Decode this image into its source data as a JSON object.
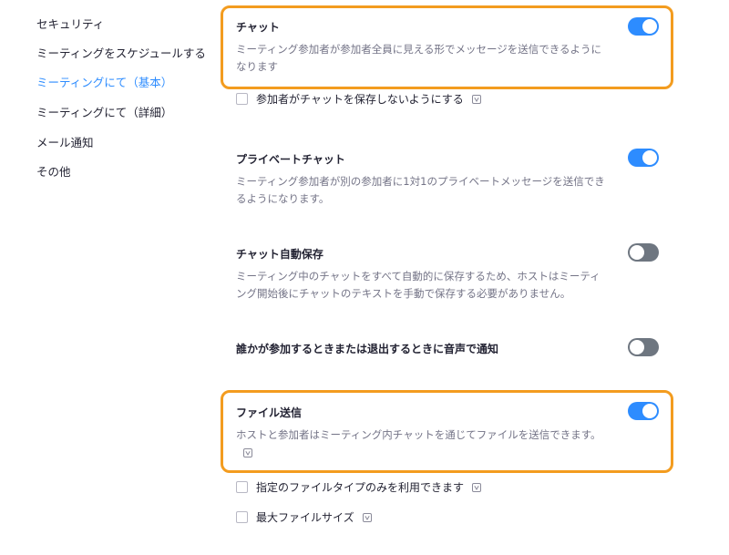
{
  "sidebar": {
    "items": [
      {
        "label": "セキュリティ",
        "active": false
      },
      {
        "label": "ミーティングをスケジュールする",
        "active": false
      },
      {
        "label": "ミーティングにて（基本）",
        "active": true
      },
      {
        "label": "ミーティングにて（詳細）",
        "active": false
      },
      {
        "label": "メール通知",
        "active": false
      },
      {
        "label": "その他",
        "active": false
      }
    ]
  },
  "settings": {
    "chat": {
      "title": "チャット",
      "desc": "ミーティング参加者が参加者全員に見える形でメッセージを送信できるようになります",
      "enabled": true,
      "highlighted": true,
      "options": [
        {
          "label": "参加者がチャットを保存しないようにする",
          "checked": false,
          "lock_icon": "lock-icon"
        }
      ]
    },
    "private_chat": {
      "title": "プライベートチャット",
      "desc": "ミーティング参加者が別の参加者に1対1のプライベートメッセージを送信できるようになります。",
      "enabled": true
    },
    "auto_save_chat": {
      "title": "チャット自動保存",
      "desc": "ミーティング中のチャットをすべて自動的に保存するため、ホストはミーティング開始後にチャットのテキストを手動で保存する必要がありません。",
      "enabled": false
    },
    "sound_notification": {
      "title": "誰かが参加するときまたは退出するときに音声で通知",
      "enabled": false
    },
    "file_transfer": {
      "title": "ファイル送信",
      "desc": "ホストと参加者はミーティング内チャットを通じてファイルを送信できます。",
      "enabled": true,
      "highlighted": true,
      "lock_icon": "lock-icon",
      "options": [
        {
          "label": "指定のファイルタイプのみを利用できます",
          "checked": false,
          "lock_icon": "lock-icon"
        },
        {
          "label": "最大ファイルサイズ",
          "checked": false,
          "lock_icon": "lock-icon"
        }
      ]
    }
  },
  "colors": {
    "accent": "#2d8cff",
    "highlight": "#f39c1f",
    "toggle_off": "#6e7680",
    "muted_text": "#747487"
  }
}
